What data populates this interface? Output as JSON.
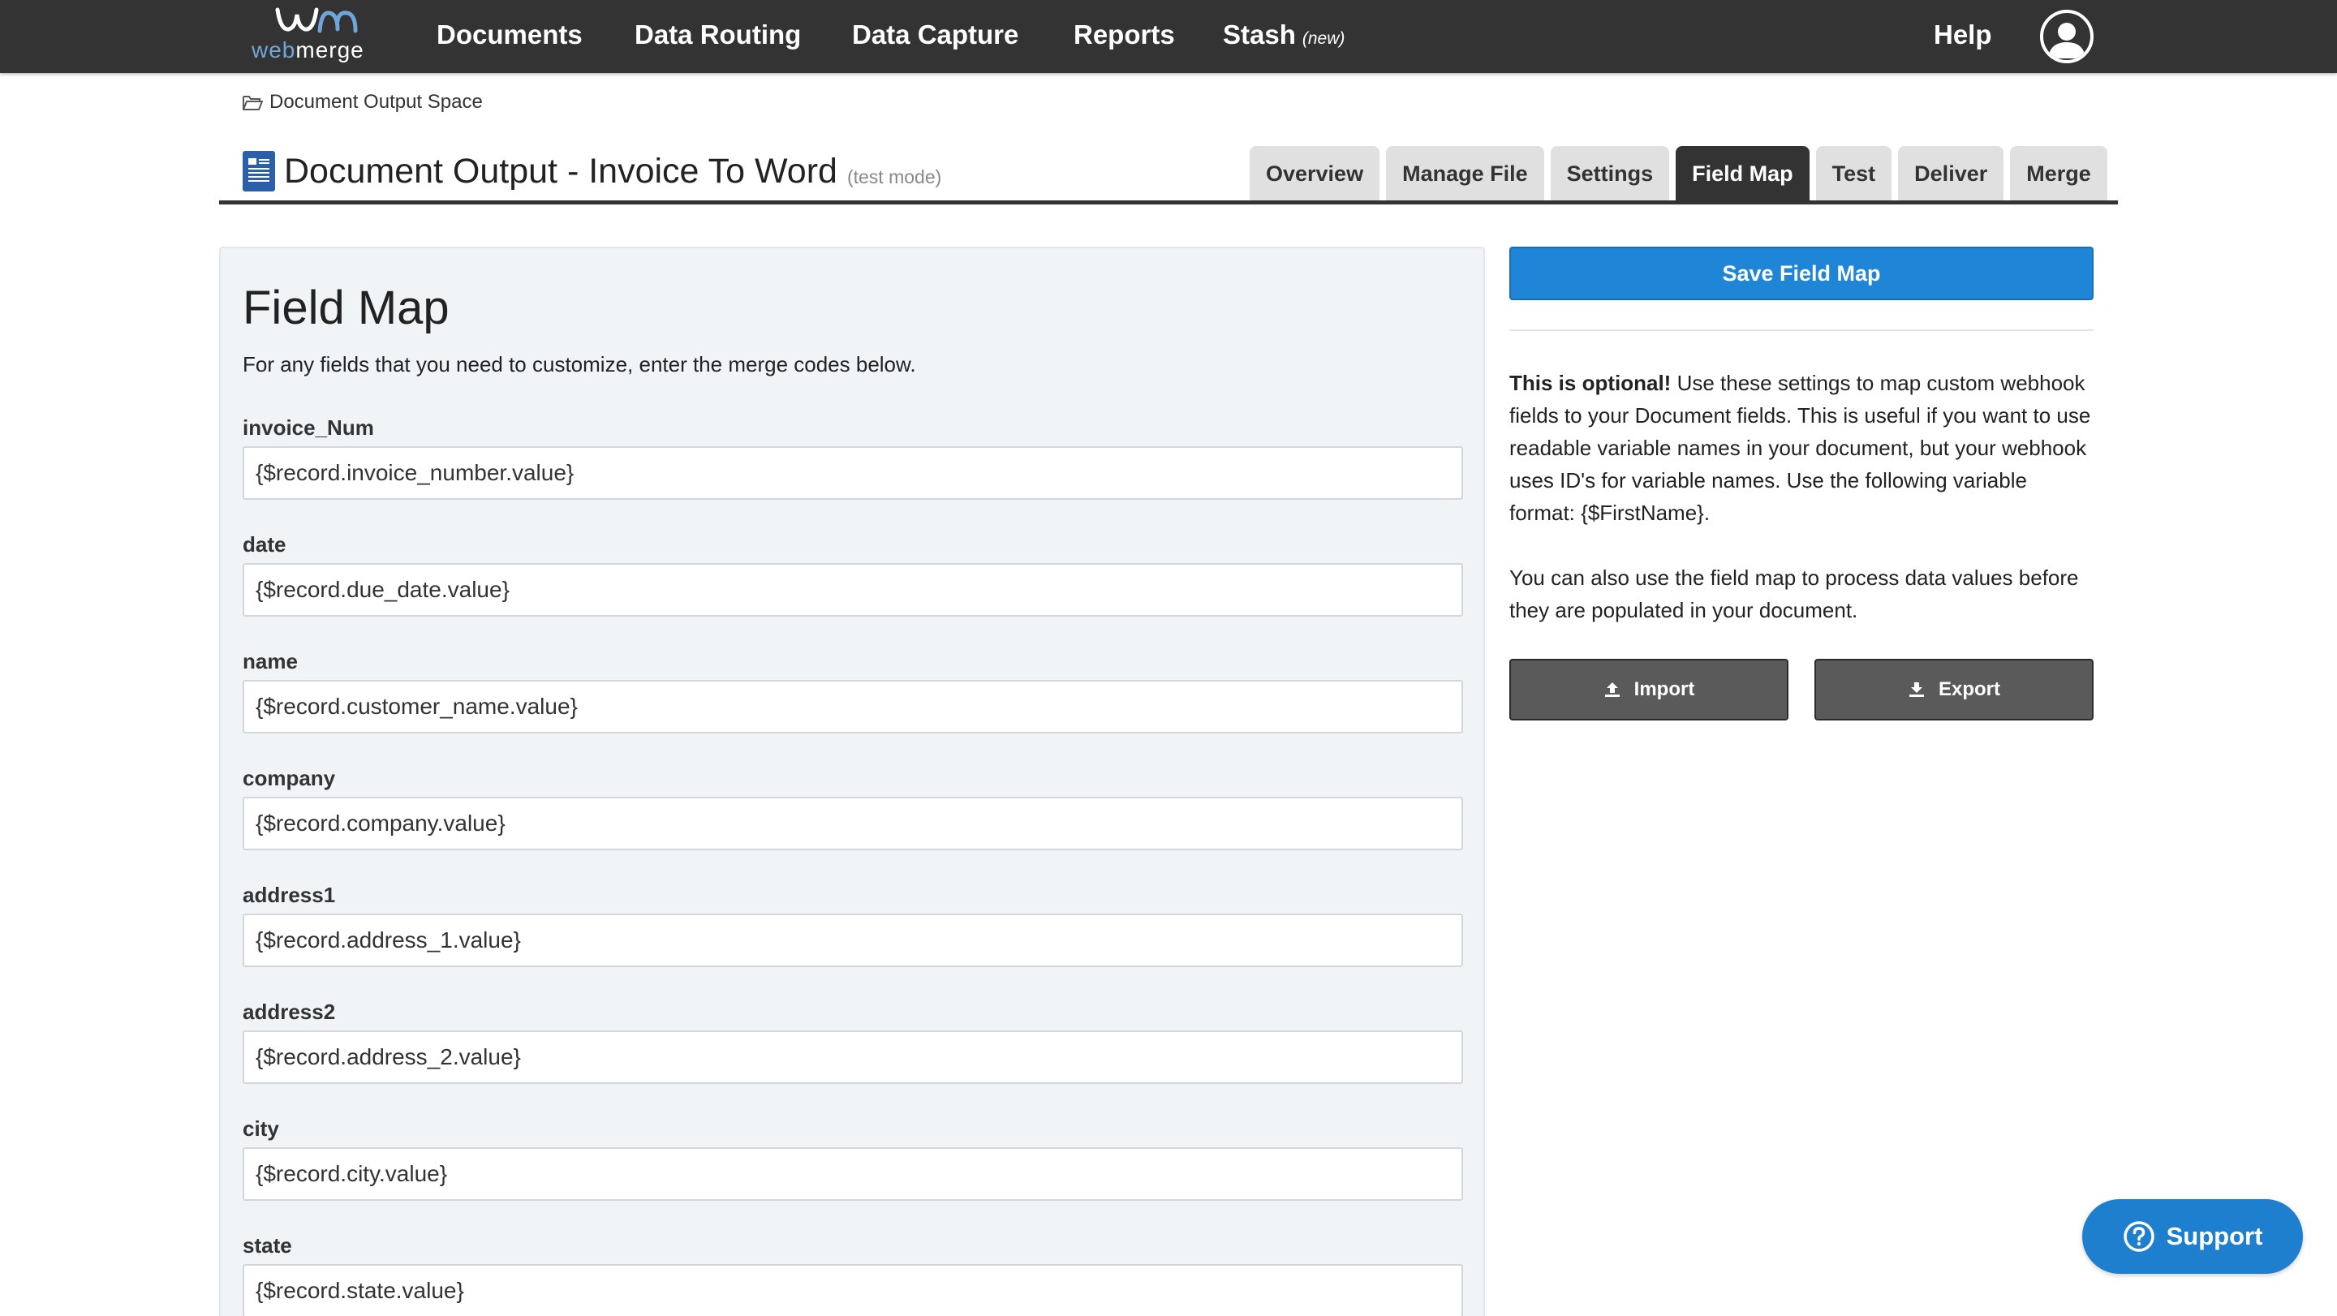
{
  "brand": {
    "logo_top": "wm",
    "logo_word_1": "web",
    "logo_word_2": "merge"
  },
  "nav": {
    "items": [
      "Documents",
      "Data Routing",
      "Data Capture",
      "Reports",
      "Stash"
    ],
    "stash_badge": "(new)",
    "help": "Help"
  },
  "breadcrumb": {
    "label": "Document Output Space"
  },
  "page": {
    "title": "Document Output - Invoice To Word",
    "mode": "(test mode)"
  },
  "tabs": [
    "Overview",
    "Manage File",
    "Settings",
    "Field Map",
    "Test",
    "Deliver",
    "Merge"
  ],
  "active_tab": "Field Map",
  "fieldmap": {
    "title": "Field Map",
    "description": "For any fields that you need to customize, enter the merge codes below.",
    "fields": [
      {
        "label": "invoice_Num",
        "value": "{$record.invoice_number.value}"
      },
      {
        "label": "date",
        "value": "{$record.due_date.value}"
      },
      {
        "label": "name",
        "value": "{$record.customer_name.value}"
      },
      {
        "label": "company",
        "value": "{$record.company.value}"
      },
      {
        "label": "address1",
        "value": "{$record.address_1.value}"
      },
      {
        "label": "address2",
        "value": "{$record.address_2.value}"
      },
      {
        "label": "city",
        "value": "{$record.city.value}"
      },
      {
        "label": "state",
        "value": "{$record.state.value}"
      }
    ]
  },
  "sidebar": {
    "save_label": "Save Field Map",
    "info_bold": "This is optional!",
    "info_text": " Use these settings to map custom webhook fields to your Document fields. This is useful if you want to use readable variable names in your document, but your webhook uses ID's for variable names. Use the following variable format: {$FirstName}.",
    "info_text_2": "You can also use the field map to process data values before they are populated in your document.",
    "import_label": "Import",
    "export_label": "Export"
  },
  "support": {
    "label": "Support"
  },
  "colors": {
    "nav_bg": "#333333",
    "primary_button": "#1f85d6",
    "panel_bg": "#f0f4f6",
    "secondary_button": "#5a5a5a",
    "support_button": "#1f7fcf",
    "logo_accent": "#6ea6dc"
  },
  "icons": {
    "breadcrumb": "folder-open-icon",
    "document": "word-document-icon",
    "user": "user-avatar-icon",
    "import": "upload-icon",
    "export": "download-icon",
    "support": "question-circle-icon"
  }
}
